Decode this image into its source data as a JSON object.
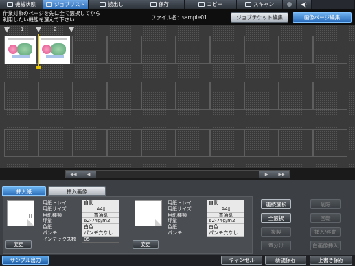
{
  "topbar": {
    "tabs": [
      {
        "label": "機械状態",
        "icon": "machine-status-icon"
      },
      {
        "label": "ジョブリスト",
        "icon": "job-list-icon",
        "active": true
      },
      {
        "label": "読出し",
        "icon": "read-icon"
      },
      {
        "label": "保存",
        "icon": "save-icon"
      },
      {
        "label": "コピー",
        "icon": "copy-icon"
      },
      {
        "label": "スキャン",
        "icon": "scan-icon"
      }
    ],
    "volume_glyph": "◀)"
  },
  "info": {
    "message": "作業対象のページを先に全て選択してから\n利用したい機能を選んで下さい",
    "filename_label": "ファイル名：sample01",
    "job_ticket_button": "ジョブチケット編集",
    "image_page_button": "画像ページ編集"
  },
  "grid": {
    "page_markers": [
      "1",
      "2"
    ],
    "scroll": {
      "first": "◀◀",
      "prev": "◀",
      "next": "▶",
      "last": "▶▶"
    }
  },
  "lower": {
    "tabs": {
      "insert_paper": "挿入紙",
      "insert_image": "挿入画像"
    },
    "left_props": [
      {
        "key": "用紙トレイ",
        "value": "自動"
      },
      {
        "key": "用紙サイズ",
        "value": "A4▯"
      },
      {
        "key": "用紙種類",
        "value": "普通紙"
      },
      {
        "key": "坪量",
        "value": "62-74g/m2"
      },
      {
        "key": "色紙",
        "value": "白色"
      },
      {
        "key": "パンチ",
        "value": "パンチ穴なし"
      },
      {
        "key": "インデックス数",
        "value": "05"
      }
    ],
    "right_props": [
      {
        "key": "用紙トレイ",
        "value": "自動"
      },
      {
        "key": "用紙サイズ",
        "value": "A4▯"
      },
      {
        "key": "用紙種類",
        "value": "普通紙"
      },
      {
        "key": "坪量",
        "value": "62-74g/m2"
      },
      {
        "key": "色紙",
        "value": "白色"
      },
      {
        "key": "パンチ",
        "value": "パンチ穴なし"
      }
    ],
    "change_label": "変更",
    "actions": {
      "continuous_select": "連続選択",
      "delete": "削除",
      "select_all": "全選択",
      "rotate": "回転",
      "copy": "複製",
      "insert_move": "挿入/移動",
      "chapter": "章分け",
      "blank_insert": "白画像挿入"
    }
  },
  "bottom": {
    "sample_output": "サンプル出力",
    "cancel": "キャンセル",
    "new_save": "新規保存",
    "overwrite_save": "上書き保存"
  }
}
